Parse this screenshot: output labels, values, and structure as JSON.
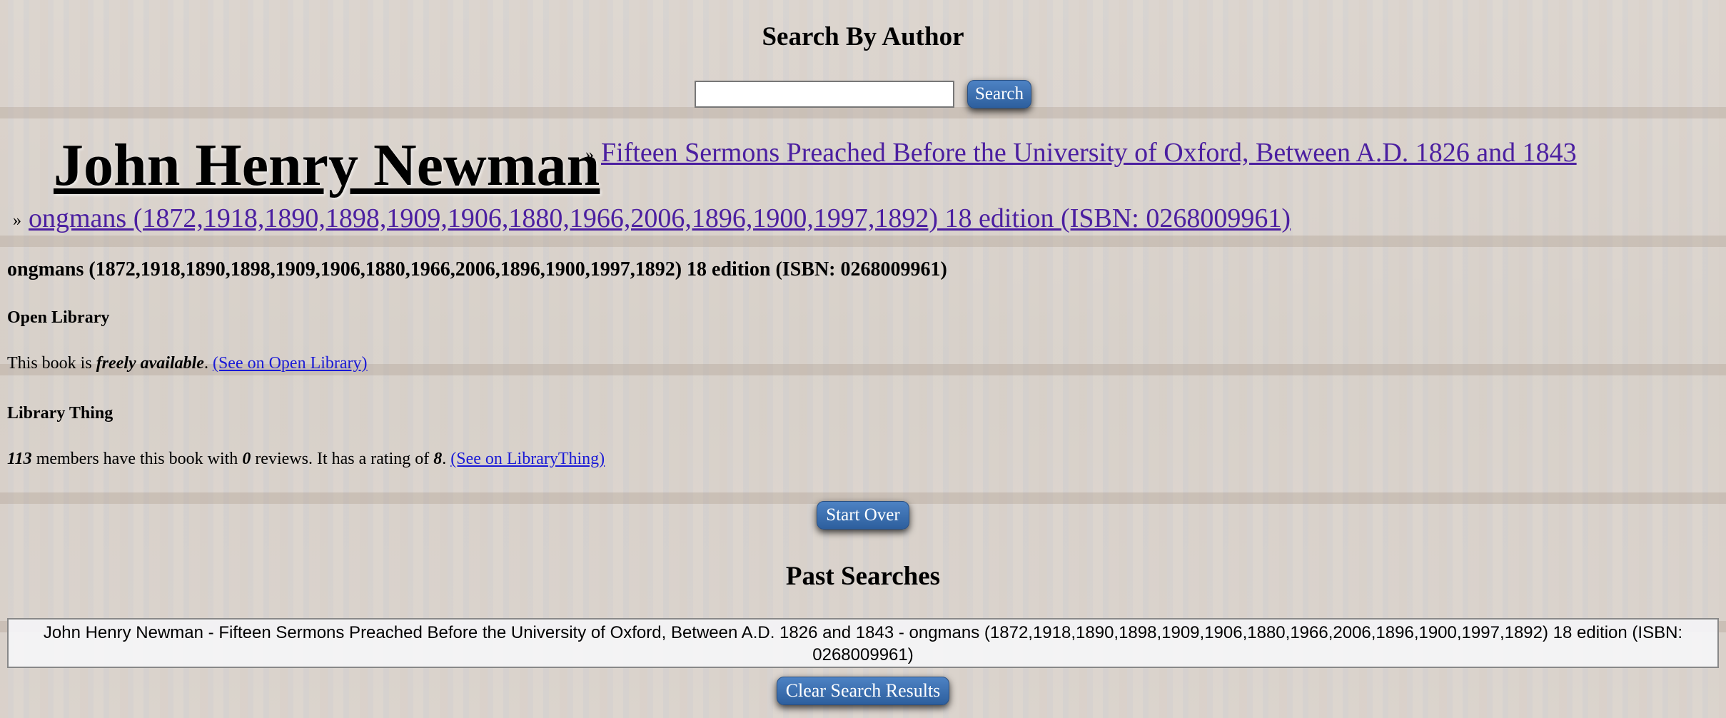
{
  "search": {
    "title": "Search By Author",
    "input_value": "",
    "button_label": "Search"
  },
  "author": {
    "name": "John Henry Newman"
  },
  "results": {
    "bullet": "»",
    "book_title": "Fifteen Sermons Preached Before the University of Oxford, Between A.D. 1826 and 1843",
    "edition_link": "ongmans (1872,1918,1890,1898,1909,1906,1880,1966,2006,1896,1900,1997,1892) 18 edition (ISBN: 0268009961)"
  },
  "edition": {
    "heading": "ongmans (1872,1918,1890,1898,1909,1906,1880,1966,2006,1896,1900,1997,1892) 18 edition (ISBN: 0268009961)"
  },
  "open_library": {
    "heading": "Open Library",
    "text_prefix": "This book is ",
    "availability": "freely available",
    "text_suffix": ". ",
    "link_label": "(See on Open Library)"
  },
  "library_thing": {
    "heading": "Library Thing",
    "members": "113",
    "text_members": " members have this book with ",
    "reviews": "0",
    "text_reviews": " reviews. It has a rating of ",
    "rating": "8",
    "text_end": ". ",
    "link_label": "(See on LibraryThing)"
  },
  "buttons": {
    "start_over": "Start Over",
    "clear_results": "Clear Search Results"
  },
  "past_searches": {
    "title": "Past Searches",
    "entries": [
      "John Henry Newman - Fifteen Sermons Preached Before the University of Oxford, Between A.D. 1826 and 1843 - ongmans (1872,1918,1890,1898,1909,1906,1880,1966,2006,1896,1900,1997,1892) 18 edition (ISBN: 0268009961)"
    ]
  },
  "colors": {
    "button_blue": "#3a6fb0",
    "link_purple": "#4b1fa0",
    "link_blue": "#1a1ad6"
  }
}
